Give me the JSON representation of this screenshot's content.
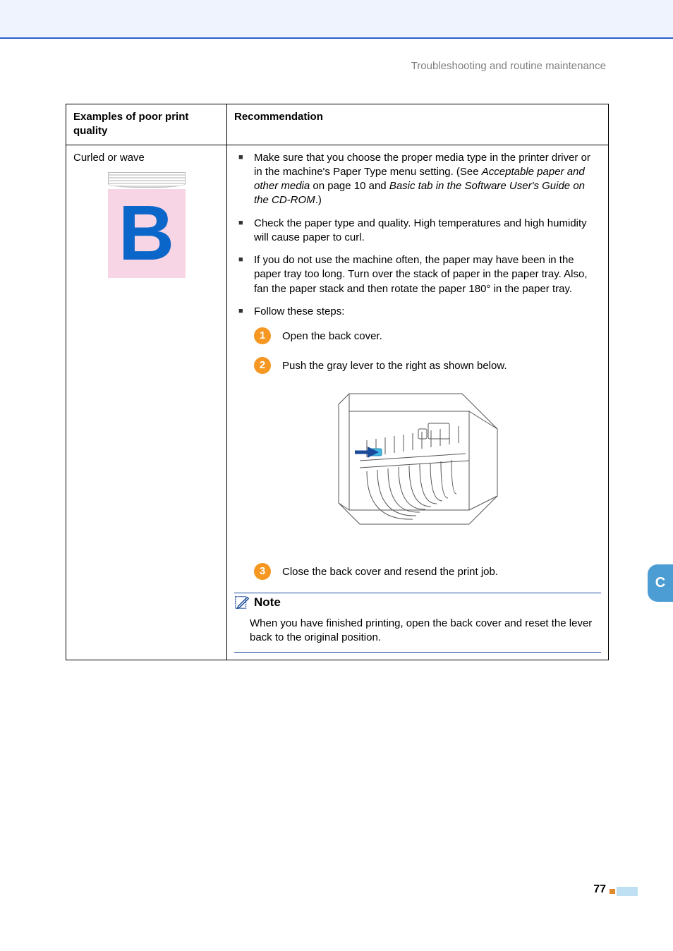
{
  "header": {
    "breadcrumb": "Troubleshooting and routine maintenance"
  },
  "table": {
    "col1_header": "Examples of poor print quality",
    "col2_header": "Recommendation",
    "row1": {
      "left_label": "Curled or wave",
      "bullets": {
        "b1_pre": "Make sure that you choose the proper media type in the printer driver or in the machine's Paper Type menu setting. (See ",
        "b1_ital1": "Acceptable paper and other media",
        "b1_mid": " on page 10 and ",
        "b1_ital2": "Basic tab in the Software User's Guide on the CD-ROM",
        "b1_post": ".)",
        "b2": "Check the paper type and quality. High temperatures and high humidity will cause paper to curl.",
        "b3": "If you do not use the machine often, the paper may have been in the paper tray too long. Turn over the stack of paper in the paper tray. Also, fan the paper stack and then rotate the paper 180° in the paper tray.",
        "b4": "Follow these steps:"
      },
      "steps": {
        "n1": "1",
        "s1": "Open the back cover.",
        "n2": "2",
        "s2": "Push the gray lever to the right as shown below.",
        "n3": "3",
        "s3": "Close the back cover and resend the print job."
      },
      "note": {
        "title": "Note",
        "body": "When you have finished printing, open the back cover and reset the lever back to the original position."
      }
    }
  },
  "side_tab": "C",
  "page_number": "77"
}
